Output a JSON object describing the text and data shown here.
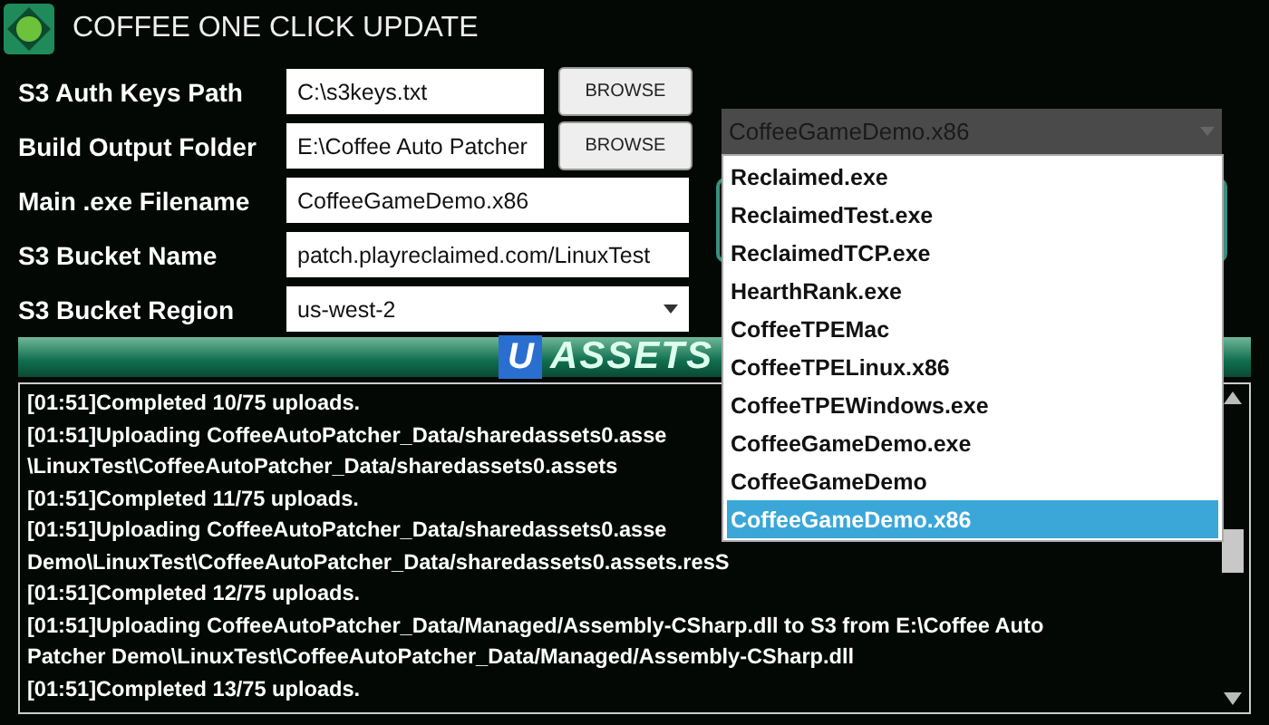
{
  "window": {
    "title": "COFFEE ONE CLICK UPDATE"
  },
  "form": [
    {
      "label": "S3 Auth Keys Path",
      "kind": "text",
      "value": "C:\\s3keys.txt",
      "button": "BROWSE"
    },
    {
      "label": "Build Output Folder",
      "kind": "text",
      "value": "E:\\Coffee Auto Patcher",
      "button": "BROWSE"
    },
    {
      "label": "Main .exe Filename",
      "kind": "text",
      "value": "CoffeeGameDemo.x86"
    },
    {
      "label": "S3 Bucket Name",
      "kind": "text",
      "value": "patch.playreclaimed.com/LinuxTest"
    },
    {
      "label": "S3 Bucket Region",
      "kind": "select",
      "value": "us-west-2"
    }
  ],
  "banner": {
    "badge": "U",
    "text": "ASSETS"
  },
  "exe_dropdown": {
    "value": "CoffeeGameDemo.x86",
    "expanded": true,
    "items": [
      {
        "label": "Reclaimed.exe",
        "selected": false
      },
      {
        "label": "ReclaimedTest.exe",
        "selected": false
      },
      {
        "label": "ReclaimedTCP.exe",
        "selected": false
      },
      {
        "label": "HearthRank.exe",
        "selected": false
      },
      {
        "label": "CoffeeTPEMac",
        "selected": false
      },
      {
        "label": "CoffeeTPELinux.x86",
        "selected": false
      },
      {
        "label": "CoffeeTPEWindows.exe",
        "selected": false
      },
      {
        "label": "CoffeeGameDemo.exe",
        "selected": false
      },
      {
        "label": "CoffeeGameDemo",
        "selected": false
      },
      {
        "label": "CoffeeGameDemo.x86",
        "selected": true
      }
    ]
  },
  "log": [
    "[01:51]Completed 10/75 uploads.",
    "[01:51]Uploading CoffeeAutoPatcher_Data/sharedassets0.asse",
    "\\LinuxTest\\CoffeeAutoPatcher_Data/sharedassets0.assets",
    "[01:51]Completed 11/75 uploads.",
    "[01:51]Uploading CoffeeAutoPatcher_Data/sharedassets0.asse",
    "Demo\\LinuxTest\\CoffeeAutoPatcher_Data/sharedassets0.assets.resS",
    "[01:51]Completed 12/75 uploads.",
    "[01:51]Uploading CoffeeAutoPatcher_Data/Managed/Assembly-CSharp.dll to S3 from E:\\Coffee Auto",
    "Patcher Demo\\LinuxTest\\CoffeeAutoPatcher_Data/Managed/Assembly-CSharp.dll",
    "[01:51]Completed 13/75 uploads."
  ]
}
